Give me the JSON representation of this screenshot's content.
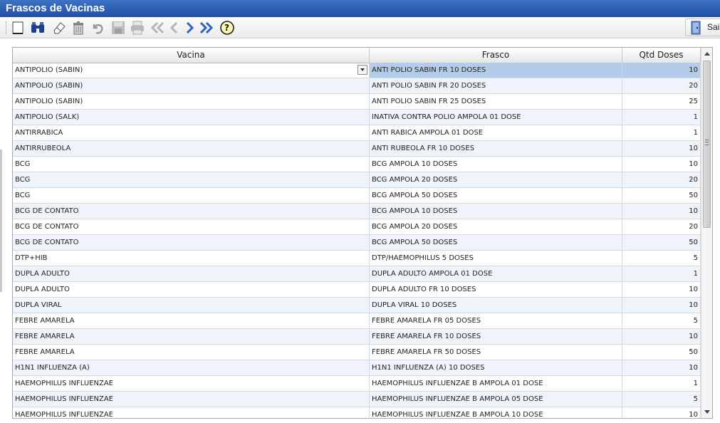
{
  "window": {
    "title": "Frascos de Vacinas"
  },
  "toolbar": {
    "exit_label": "Sair",
    "buttons": [
      "new-icon",
      "search-binoculars-icon",
      "clear-eraser-icon",
      "delete-trash-icon",
      "undo-icon",
      "save-icon",
      "print-icon",
      "first-icon",
      "previous-icon",
      "next-icon",
      "last-icon",
      "help-icon"
    ]
  },
  "grid": {
    "columns": [
      "Vacina",
      "Frasco",
      "Qtd Doses"
    ],
    "selected_row": 0,
    "rows": [
      [
        "ANTIPOLIO (SABIN)",
        "ANTI POLIO SABIN FR 10 DOSES",
        "10"
      ],
      [
        "ANTIPOLIO (SABIN)",
        "ANTI POLIO SABIN FR 20 DOSES",
        "20"
      ],
      [
        "ANTIPOLIO (SABIN)",
        "ANTI POLIO SABIN FR 25 DOSES",
        "25"
      ],
      [
        "ANTIPOLIO (SALK)",
        "INATIVA CONTRA POLIO AMPOLA 01 DOSE",
        "1"
      ],
      [
        "ANTIRRABICA",
        "ANTI RABICA AMPOLA 01 DOSE",
        "1"
      ],
      [
        "ANTIRRUBEOLA",
        "ANTI RUBEOLA FR 10 DOSES",
        "10"
      ],
      [
        "BCG",
        "BCG AMPOLA 10 DOSES",
        "10"
      ],
      [
        "BCG",
        "BCG AMPOLA 20 DOSES",
        "20"
      ],
      [
        "BCG",
        "BCG AMPOLA 50 DOSES",
        "50"
      ],
      [
        "BCG DE CONTATO",
        "BCG AMPOLA 10 DOSES",
        "10"
      ],
      [
        "BCG DE CONTATO",
        "BCG AMPOLA 20 DOSES",
        "20"
      ],
      [
        "BCG DE CONTATO",
        "BCG AMPOLA 50 DOSES",
        "50"
      ],
      [
        "DTP+HIB",
        "DTP/HAEMOPHILUS 5 DOSES",
        "5"
      ],
      [
        "DUPLA ADULTO",
        "DUPLA ADULTO AMPOLA 01 DOSE",
        "1"
      ],
      [
        "DUPLA ADULTO",
        "DUPLA ADULTO FR 10 DOSES",
        "10"
      ],
      [
        "DUPLA VIRAL",
        "DUPLA VIRAL 10 DOSES",
        "10"
      ],
      [
        "FEBRE AMARELA",
        "FEBRE AMARELA FR 05 DOSES",
        "5"
      ],
      [
        "FEBRE AMARELA",
        "FEBRE AMARELA FR 10 DOSES",
        "10"
      ],
      [
        "FEBRE AMARELA",
        "FEBRE AMARELA FR 50 DOSES",
        "50"
      ],
      [
        "H1N1 INFLUENZA (A)",
        "H1N1 INFLUENZA (A) 10 DOSES",
        "10"
      ],
      [
        "HAEMOPHILUS INFLUENZAE",
        "HAEMOPHILUS INFLUENZAE B AMPOLA 01 DOSE",
        "1"
      ],
      [
        "HAEMOPHILUS INFLUENZAE",
        "HAEMOPHILUS INFLUENZAE B AMPOLA 05 DOSE",
        "5"
      ],
      [
        "HAEMOPHILUS INFLUENZAE",
        "HAEMOPHILUS INFLUENZAE B AMPOLA 10 DOSE",
        "10"
      ]
    ]
  },
  "colors": {
    "title_bar": "#2a5db3",
    "selection": "#b4cbea",
    "row_alt": "#eef4fa"
  }
}
